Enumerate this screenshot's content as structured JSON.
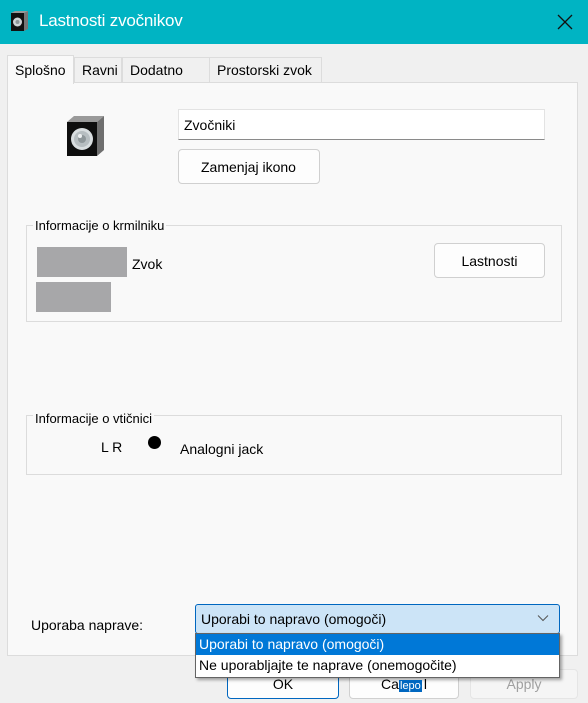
{
  "window": {
    "title": "Lastnosti zvočnikov",
    "title_icon": "speaker-icon",
    "close_icon": "close-icon",
    "accent_color": "#00b4c3"
  },
  "tabs": [
    {
      "label": "Splošno",
      "active": true
    },
    {
      "label": "Ravni",
      "active": false
    },
    {
      "label": "Dodatno",
      "active": false
    },
    {
      "label": "Prostorski zvok",
      "active": false
    }
  ],
  "general": {
    "device_icon": "speaker-icon",
    "name_value": "Zvočniki",
    "change_icon_label": "Zamenjaj ikono",
    "controller_group": {
      "label": "Informacije o krmilniku",
      "line1_suffix": "Zvok",
      "line1_redacted": true,
      "line2_redacted": true,
      "properties_label": "Lastnosti"
    },
    "jack_group": {
      "label": "Informacije o vtičnici",
      "channels": "L R",
      "jack_color": "#000000",
      "jack_label": "Analogni jack"
    },
    "device_usage": {
      "label": "Uporaba naprave:",
      "selected": "Uporabi to napravo (omogoči)",
      "chevron_icon": "chevron-down-icon",
      "options": [
        {
          "label": "Uporabi to napravo (omogoči)",
          "highlighted": true
        },
        {
          "label": "Ne uporabljajte te naprave (onemogočite)",
          "highlighted": false
        }
      ]
    }
  },
  "footer": {
    "ok_label": "OK",
    "cancel_label_visible": "Ca",
    "cancel_suffix_visible": "l",
    "overlay_fragment": "lepo",
    "apply_label": "Apply"
  }
}
